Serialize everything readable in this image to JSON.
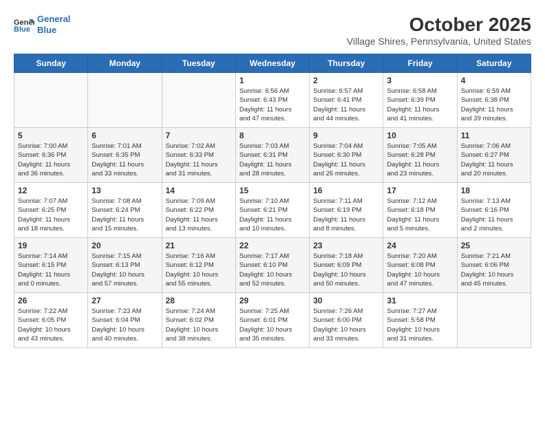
{
  "header": {
    "logo_line1": "General",
    "logo_line2": "Blue",
    "month": "October 2025",
    "location": "Village Shires, Pennsylvania, United States"
  },
  "weekdays": [
    "Sunday",
    "Monday",
    "Tuesday",
    "Wednesday",
    "Thursday",
    "Friday",
    "Saturday"
  ],
  "weeks": [
    [
      {
        "day": "",
        "info": ""
      },
      {
        "day": "",
        "info": ""
      },
      {
        "day": "",
        "info": ""
      },
      {
        "day": "1",
        "info": "Sunrise: 6:56 AM\nSunset: 6:43 PM\nDaylight: 11 hours\nand 47 minutes."
      },
      {
        "day": "2",
        "info": "Sunrise: 6:57 AM\nSunset: 6:41 PM\nDaylight: 11 hours\nand 44 minutes."
      },
      {
        "day": "3",
        "info": "Sunrise: 6:58 AM\nSunset: 6:39 PM\nDaylight: 11 hours\nand 41 minutes."
      },
      {
        "day": "4",
        "info": "Sunrise: 6:59 AM\nSunset: 6:38 PM\nDaylight: 11 hours\nand 39 minutes."
      }
    ],
    [
      {
        "day": "5",
        "info": "Sunrise: 7:00 AM\nSunset: 6:36 PM\nDaylight: 11 hours\nand 36 minutes."
      },
      {
        "day": "6",
        "info": "Sunrise: 7:01 AM\nSunset: 6:35 PM\nDaylight: 11 hours\nand 33 minutes."
      },
      {
        "day": "7",
        "info": "Sunrise: 7:02 AM\nSunset: 6:33 PM\nDaylight: 11 hours\nand 31 minutes."
      },
      {
        "day": "8",
        "info": "Sunrise: 7:03 AM\nSunset: 6:31 PM\nDaylight: 11 hours\nand 28 minutes."
      },
      {
        "day": "9",
        "info": "Sunrise: 7:04 AM\nSunset: 6:30 PM\nDaylight: 11 hours\nand 26 minutes."
      },
      {
        "day": "10",
        "info": "Sunrise: 7:05 AM\nSunset: 6:28 PM\nDaylight: 11 hours\nand 23 minutes."
      },
      {
        "day": "11",
        "info": "Sunrise: 7:06 AM\nSunset: 6:27 PM\nDaylight: 11 hours\nand 20 minutes."
      }
    ],
    [
      {
        "day": "12",
        "info": "Sunrise: 7:07 AM\nSunset: 6:25 PM\nDaylight: 11 hours\nand 18 minutes."
      },
      {
        "day": "13",
        "info": "Sunrise: 7:08 AM\nSunset: 6:24 PM\nDaylight: 11 hours\nand 15 minutes."
      },
      {
        "day": "14",
        "info": "Sunrise: 7:09 AM\nSunset: 6:22 PM\nDaylight: 11 hours\nand 13 minutes."
      },
      {
        "day": "15",
        "info": "Sunrise: 7:10 AM\nSunset: 6:21 PM\nDaylight: 11 hours\nand 10 minutes."
      },
      {
        "day": "16",
        "info": "Sunrise: 7:11 AM\nSunset: 6:19 PM\nDaylight: 11 hours\nand 8 minutes."
      },
      {
        "day": "17",
        "info": "Sunrise: 7:12 AM\nSunset: 6:18 PM\nDaylight: 11 hours\nand 5 minutes."
      },
      {
        "day": "18",
        "info": "Sunrise: 7:13 AM\nSunset: 6:16 PM\nDaylight: 11 hours\nand 2 minutes."
      }
    ],
    [
      {
        "day": "19",
        "info": "Sunrise: 7:14 AM\nSunset: 6:15 PM\nDaylight: 11 hours\nand 0 minutes."
      },
      {
        "day": "20",
        "info": "Sunrise: 7:15 AM\nSunset: 6:13 PM\nDaylight: 10 hours\nand 57 minutes."
      },
      {
        "day": "21",
        "info": "Sunrise: 7:16 AM\nSunset: 6:12 PM\nDaylight: 10 hours\nand 55 minutes."
      },
      {
        "day": "22",
        "info": "Sunrise: 7:17 AM\nSunset: 6:10 PM\nDaylight: 10 hours\nand 52 minutes."
      },
      {
        "day": "23",
        "info": "Sunrise: 7:18 AM\nSunset: 6:09 PM\nDaylight: 10 hours\nand 50 minutes."
      },
      {
        "day": "24",
        "info": "Sunrise: 7:20 AM\nSunset: 6:08 PM\nDaylight: 10 hours\nand 47 minutes."
      },
      {
        "day": "25",
        "info": "Sunrise: 7:21 AM\nSunset: 6:06 PM\nDaylight: 10 hours\nand 45 minutes."
      }
    ],
    [
      {
        "day": "26",
        "info": "Sunrise: 7:22 AM\nSunset: 6:05 PM\nDaylight: 10 hours\nand 43 minutes."
      },
      {
        "day": "27",
        "info": "Sunrise: 7:23 AM\nSunset: 6:04 PM\nDaylight: 10 hours\nand 40 minutes."
      },
      {
        "day": "28",
        "info": "Sunrise: 7:24 AM\nSunset: 6:02 PM\nDaylight: 10 hours\nand 38 minutes."
      },
      {
        "day": "29",
        "info": "Sunrise: 7:25 AM\nSunset: 6:01 PM\nDaylight: 10 hours\nand 35 minutes."
      },
      {
        "day": "30",
        "info": "Sunrise: 7:26 AM\nSunset: 6:00 PM\nDaylight: 10 hours\nand 33 minutes."
      },
      {
        "day": "31",
        "info": "Sunrise: 7:27 AM\nSunset: 5:58 PM\nDaylight: 10 hours\nand 31 minutes."
      },
      {
        "day": "",
        "info": ""
      }
    ]
  ]
}
